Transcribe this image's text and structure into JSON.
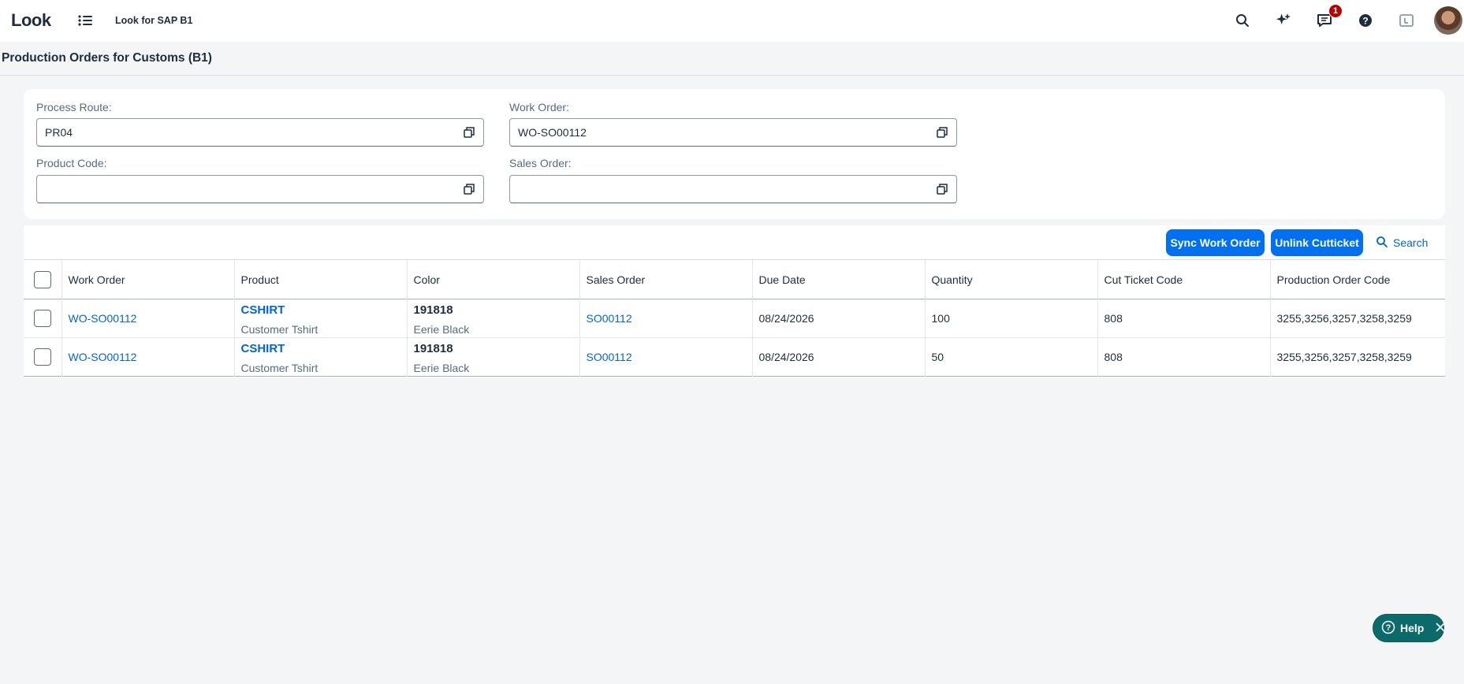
{
  "shell": {
    "logo": "Look",
    "app_title": "Look for SAP B1",
    "icons": [
      "search-icon",
      "sparkle-ai-icon",
      "notifications-icon",
      "help-icon",
      "side-panel-icon"
    ],
    "notification_count": "1"
  },
  "page": {
    "title": "Production Orders for Customs (B1)"
  },
  "filters": {
    "process_route": {
      "label": "Process Route:",
      "value": "PR04"
    },
    "work_order": {
      "label": "Work Order:",
      "value": "WO-SO00112"
    },
    "product_code": {
      "label": "Product Code:",
      "value": ""
    },
    "sales_order": {
      "label": "Sales Order:",
      "value": ""
    }
  },
  "toolbar": {
    "sync_label": "Sync Work Order",
    "unlink_label": "Unlink Cutticket",
    "search_label": "Search"
  },
  "table": {
    "columns": [
      "Work Order",
      "Product",
      "Color",
      "Sales Order",
      "Due Date",
      "Quantity",
      "Cut Ticket Code",
      "Production Order Code"
    ],
    "rows": [
      {
        "work_order": "WO-SO00112",
        "product_code": "CSHIRT",
        "product_name": "Customer Tshirt",
        "color_code": "191818",
        "color_name": "Eerie Black",
        "sales_order": "SO00112",
        "due_date": "08/24/2026",
        "quantity": "100",
        "cut_ticket_code": "808",
        "production_order_code": "3255,3256,3257,3258,3259"
      },
      {
        "work_order": "WO-SO00112",
        "product_code": "CSHIRT",
        "product_name": "Customer Tshirt",
        "color_code": "191818",
        "color_name": "Eerie Black",
        "sales_order": "SO00112",
        "due_date": "08/24/2026",
        "quantity": "50",
        "cut_ticket_code": "808",
        "production_order_code": "3255,3256,3257,3258,3259"
      }
    ]
  },
  "help_widget": {
    "label": "Help"
  },
  "colors": {
    "accent": "#0070f2",
    "link": "#0064d9",
    "help_bg": "#0b6b6a",
    "badge": "#bb0000"
  }
}
